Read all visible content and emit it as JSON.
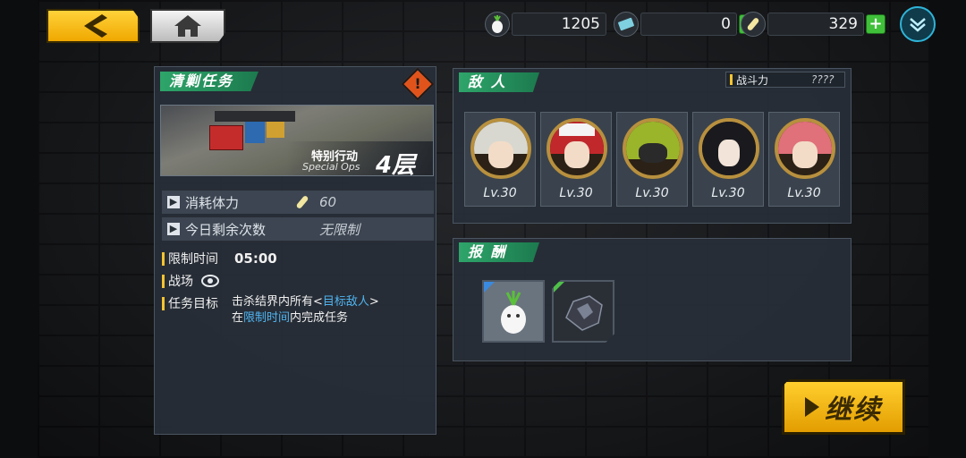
{
  "resources": {
    "stamina": {
      "value": "1205"
    },
    "tickets": {
      "value": "0"
    },
    "energy": {
      "value": "329"
    }
  },
  "mission": {
    "title": "清剿任务",
    "image_label_cn": "特别行动",
    "image_label_en": "Special Ops",
    "floor": "4层",
    "rows": [
      {
        "label": "消耗体力",
        "value": "60"
      },
      {
        "label": "今日剩余次数",
        "value": "无限制"
      }
    ],
    "time_limit_label": "限制时间",
    "time_limit_value": "05:00",
    "battlefield_label": "战场",
    "objective_label": "任务目标",
    "objective_line1_prefix": "击杀结界内所有<",
    "objective_line1_highlight": "目标敌人",
    "objective_line1_suffix": ">",
    "objective_line2_prefix": "在",
    "objective_line2_highlight": "限制时间",
    "objective_line2_suffix": "内完成任务"
  },
  "enemies": {
    "title": "敌 人",
    "power_label": "战斗力",
    "power_value": "????",
    "list": [
      {
        "level": "Lv.30",
        "hair": "#d8d8d0"
      },
      {
        "level": "Lv.30",
        "hair": "#c0282c"
      },
      {
        "level": "Lv.30",
        "hair": "#9ab52a"
      },
      {
        "level": "Lv.30",
        "hair": "#1a1a1e"
      },
      {
        "level": "Lv.30",
        "hair": "#e0707a"
      }
    ]
  },
  "rewards": {
    "title": "报 酬"
  },
  "actions": {
    "continue_label": "继续"
  },
  "colors": {
    "accent_green": "#2ea56a",
    "accent_yellow": "#f4c430",
    "highlight_blue": "#4fb4f0"
  }
}
